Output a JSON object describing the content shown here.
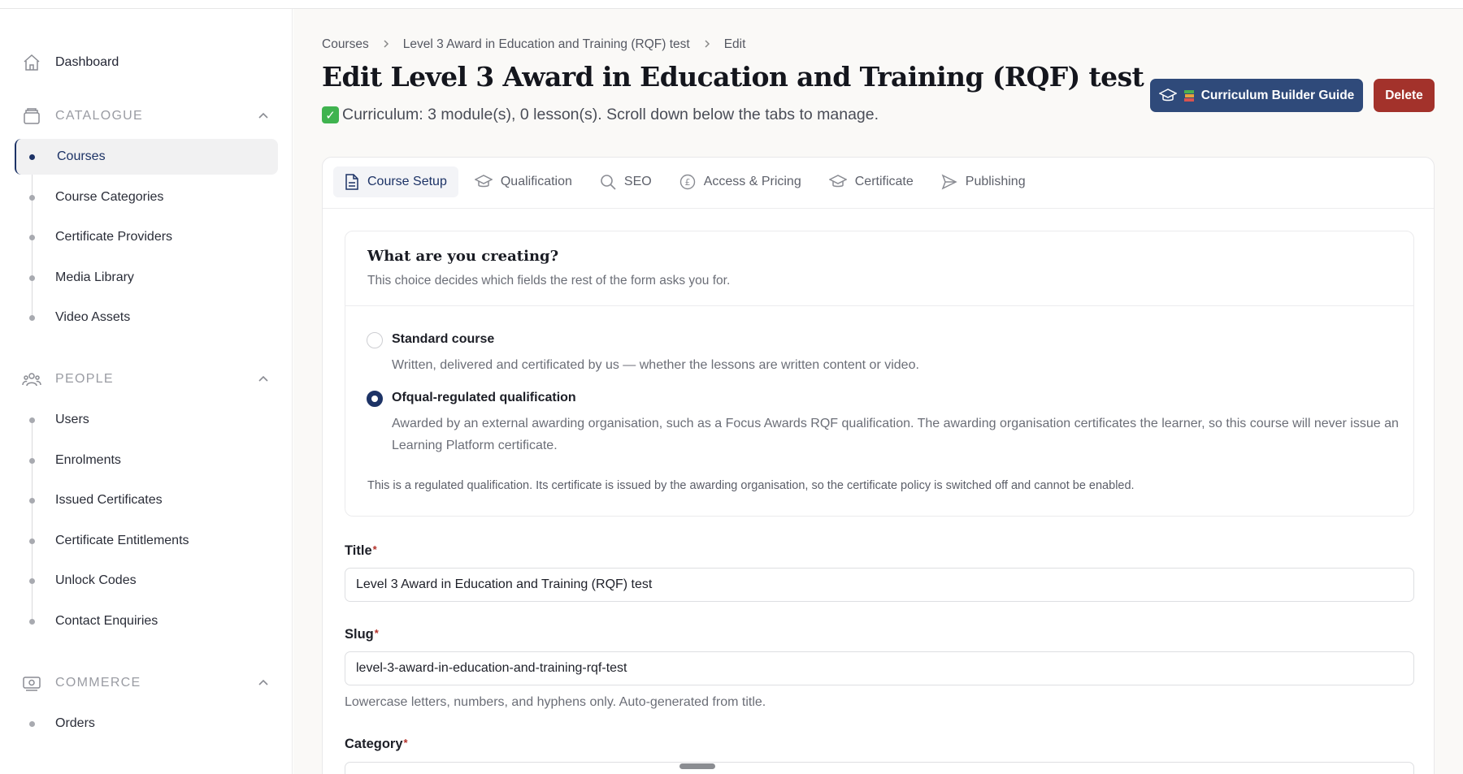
{
  "sidebar": {
    "dashboard": "Dashboard",
    "sections": {
      "catalogue": {
        "label": "CATALOGUE",
        "items": [
          "Courses",
          "Course Categories",
          "Certificate Providers",
          "Media Library",
          "Video Assets"
        ]
      },
      "people": {
        "label": "PEOPLE",
        "items": [
          "Users",
          "Enrolments",
          "Issued Certificates",
          "Certificate Entitlements",
          "Unlock Codes",
          "Contact Enquiries"
        ]
      },
      "commerce": {
        "label": "COMMERCE",
        "items": [
          "Orders"
        ]
      }
    },
    "active_item": "Courses"
  },
  "breadcrumb": [
    "Courses",
    "Level 3 Award in Education and Training (RQF) test",
    "Edit"
  ],
  "header": {
    "title": "Edit Level 3 Award in Education and Training (RQF) test",
    "subtitle": "Curriculum: 3 module(s), 0 lesson(s). Scroll down below the tabs to manage.",
    "guide_button": "Curriculum Builder Guide",
    "delete_button": "Delete"
  },
  "tabs": [
    {
      "label": "Course Setup",
      "icon": "document-icon"
    },
    {
      "label": "Qualification",
      "icon": "graduation-cap-icon"
    },
    {
      "label": "SEO",
      "icon": "search-icon"
    },
    {
      "label": "Access & Pricing",
      "icon": "pound-icon"
    },
    {
      "label": "Certificate",
      "icon": "graduation-cap-icon"
    },
    {
      "label": "Publishing",
      "icon": "send-icon"
    }
  ],
  "active_tab": "Course Setup",
  "creation_choice": {
    "title": "What are you creating?",
    "description": "This choice decides which fields the rest of the form asks you for.",
    "options": [
      {
        "label": "Standard course",
        "help": "Written, delivered and certificated by us — whether the lessons are written content or video.",
        "checked": false
      },
      {
        "label": "Ofqual-regulated qualification",
        "help": "Awarded by an external awarding organisation, such as a Focus Awards RQF qualification. The awarding organisation certificates the learner, so this course will never issue an Learning Platform certificate.",
        "checked": true
      }
    ],
    "note": "This is a regulated qualification. Its certificate is issued by the awarding organisation, so the certificate policy is switched off and cannot be enabled."
  },
  "fields": {
    "title": {
      "label": "Title",
      "required_mark": "*",
      "value": "Level 3 Award in Education and Training (RQF) test"
    },
    "slug": {
      "label": "Slug",
      "required_mark": "*",
      "value": "level-3-award-in-education-and-training-rqf-test",
      "help": "Lowercase letters, numbers, and hyphens only. Auto-generated from title."
    },
    "category": {
      "label": "Category",
      "required_mark": "*"
    }
  },
  "colors": {
    "primary": "#1d3366",
    "guide_button": "#2f4a7a",
    "delete_button": "#a3322b",
    "success_check": "#3fb34f",
    "required": "#b3312a"
  }
}
